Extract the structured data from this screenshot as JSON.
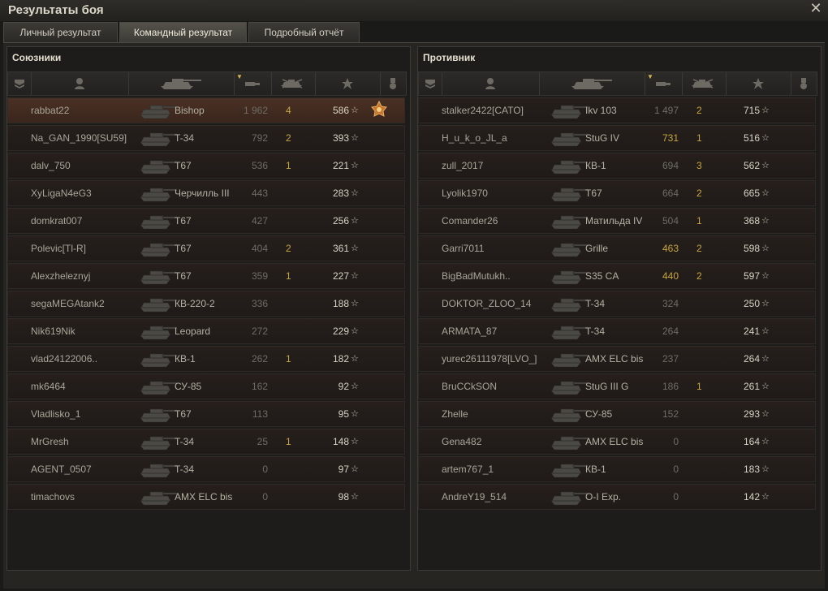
{
  "window": {
    "title": "Результаты боя",
    "close_icon": "close-icon"
  },
  "tabs": [
    {
      "label": "Личный результат",
      "active": false
    },
    {
      "label": "Командный результат",
      "active": true
    },
    {
      "label": "Подробный отчёт",
      "active": false
    }
  ],
  "allies": {
    "title": "Союзники",
    "rows": [
      {
        "name": "rabbat22",
        "tank": "Bishop",
        "damage": "1 962",
        "kills": "4",
        "xp": "586",
        "medal": true,
        "self": true
      },
      {
        "name": "Na_GAN_1990[SU59]",
        "tank": "T-34",
        "damage": "792",
        "kills": "2",
        "xp": "393"
      },
      {
        "name": "dalv_750",
        "tank": "T67",
        "damage": "536",
        "kills": "1",
        "xp": "221"
      },
      {
        "name": "XyLigaN4eG3",
        "tank": "Черчилль III",
        "damage": "443",
        "kills": "",
        "xp": "283"
      },
      {
        "name": "domkrat007",
        "tank": "T67",
        "damage": "427",
        "kills": "",
        "xp": "256"
      },
      {
        "name": "Polevic[Tl-R]",
        "tank": "T67",
        "damage": "404",
        "kills": "2",
        "xp": "361"
      },
      {
        "name": "Alexzheleznyj",
        "tank": "T67",
        "damage": "359",
        "kills": "1",
        "xp": "227"
      },
      {
        "name": "segaMEGAtank2",
        "tank": "КВ-220-2",
        "damage": "336",
        "kills": "",
        "xp": "188"
      },
      {
        "name": "Nik619Nik",
        "tank": "Leopard",
        "damage": "272",
        "kills": "",
        "xp": "229"
      },
      {
        "name": "vlad24122006..",
        "tank": "КВ-1",
        "damage": "262",
        "kills": "1",
        "xp": "182"
      },
      {
        "name": "mk6464",
        "tank": "СУ-85",
        "damage": "162",
        "kills": "",
        "xp": "92"
      },
      {
        "name": "Vladlisko_1",
        "tank": "T67",
        "damage": "113",
        "kills": "",
        "xp": "95"
      },
      {
        "name": "MrGresh",
        "tank": "T-34",
        "damage": "25",
        "kills": "1",
        "xp": "148"
      },
      {
        "name": "AGENT_0507",
        "tank": "T-34",
        "damage": "0",
        "kills": "",
        "xp": "97"
      },
      {
        "name": "timachovs",
        "tank": "AMX ELC bis",
        "damage": "0",
        "kills": "",
        "xp": "98"
      }
    ]
  },
  "enemies": {
    "title": "Противник",
    "rows": [
      {
        "name": "stalker2422[CATO]",
        "tank": "Ikv 103",
        "damage": "1 497",
        "kills": "2",
        "xp": "715"
      },
      {
        "name": "H_u_k_o_JL_a",
        "tank": "StuG IV",
        "damage": "731",
        "kills": "1",
        "xp": "516",
        "hi": true
      },
      {
        "name": "zull_2017",
        "tank": "КВ-1",
        "damage": "694",
        "kills": "3",
        "xp": "562"
      },
      {
        "name": "Lyolik1970",
        "tank": "T67",
        "damage": "664",
        "kills": "2",
        "xp": "665"
      },
      {
        "name": "Comander26",
        "tank": "Матильда IV",
        "damage": "504",
        "kills": "1",
        "xp": "368"
      },
      {
        "name": "Garri7011",
        "tank": "Grille",
        "damage": "463",
        "kills": "2",
        "xp": "598",
        "hi": true
      },
      {
        "name": "BigBadMutukh..",
        "tank": "S35 CA",
        "damage": "440",
        "kills": "2",
        "xp": "597",
        "hi": true
      },
      {
        "name": "DOKTOR_ZLOO_14",
        "tank": "T-34",
        "damage": "324",
        "kills": "",
        "xp": "250"
      },
      {
        "name": "ARMATA_87",
        "tank": "T-34",
        "damage": "264",
        "kills": "",
        "xp": "241"
      },
      {
        "name": "yurec26111978[LVO_]",
        "tank": "AMX ELC bis",
        "damage": "237",
        "kills": "",
        "xp": "264"
      },
      {
        "name": "BruCCkSON",
        "tank": "StuG III G",
        "damage": "186",
        "kills": "1",
        "xp": "261"
      },
      {
        "name": "Zhelle",
        "tank": "СУ-85",
        "damage": "152",
        "kills": "",
        "xp": "293"
      },
      {
        "name": "Gena482",
        "tank": "AMX ELC bis",
        "damage": "0",
        "kills": "",
        "xp": "164"
      },
      {
        "name": "artem767_1",
        "tank": "КВ-1",
        "damage": "0",
        "kills": "",
        "xp": "183"
      },
      {
        "name": "AndreY19_514",
        "tank": "O-I Exp.",
        "damage": "0",
        "kills": "",
        "xp": "142"
      }
    ]
  },
  "columns": [
    "squad-icon",
    "player-icon",
    "tank-icon",
    "damage-icon",
    "kills-icon",
    "xp-star-icon",
    "medal-icon"
  ],
  "colors": {
    "gold": "#c8a640",
    "self_row": "#4a3024",
    "dim_text": "#6e6c64"
  }
}
